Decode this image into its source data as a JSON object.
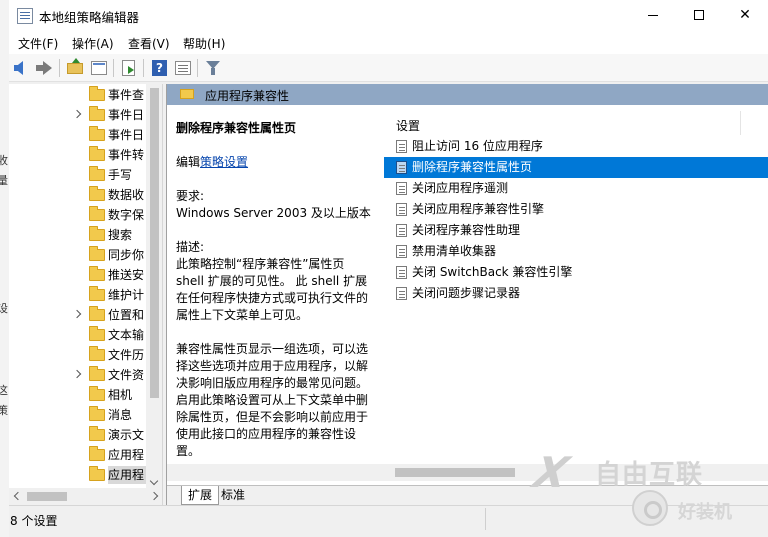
{
  "window": {
    "title": "本地组策略编辑器"
  },
  "menu": [
    "文件(F)",
    "操作(A)",
    "查看(V)",
    "帮助(H)"
  ],
  "toolbar": {
    "icons": [
      "back-arrow-icon",
      "forward-arrow-icon",
      "up-folder-icon",
      "show-hide-console-tree-icon",
      "export-list-icon",
      "help-icon",
      "properties-icon",
      "filter-icon"
    ]
  },
  "left_strip": [
    "收",
    "量",
    "设",
    "这",
    "策"
  ],
  "tree": {
    "items": [
      {
        "label": "事件查",
        "expandable": false
      },
      {
        "label": "事件日",
        "expandable": true
      },
      {
        "label": "事件日",
        "expandable": false
      },
      {
        "label": "事件转",
        "expandable": false
      },
      {
        "label": "手写",
        "expandable": false
      },
      {
        "label": "数据收",
        "expandable": false
      },
      {
        "label": "数字保",
        "expandable": false
      },
      {
        "label": "搜索",
        "expandable": false
      },
      {
        "label": "同步你",
        "expandable": false
      },
      {
        "label": "推送安",
        "expandable": false
      },
      {
        "label": "维护计",
        "expandable": false
      },
      {
        "label": "位置和",
        "expandable": true
      },
      {
        "label": "文本输",
        "expandable": false
      },
      {
        "label": "文件历",
        "expandable": false
      },
      {
        "label": "文件资",
        "expandable": true
      },
      {
        "label": "相机",
        "expandable": false
      },
      {
        "label": "消息",
        "expandable": false
      },
      {
        "label": "演示文",
        "expandable": false
      },
      {
        "label": "应用程",
        "expandable": false
      },
      {
        "label": "应用程",
        "expandable": false,
        "selected": true
      }
    ]
  },
  "header": {
    "title": "应用程序兼容性"
  },
  "extended": {
    "title": "删除程序兼容性属性页",
    "edit_prefix": "编辑",
    "edit_link": "策略设置",
    "req_label": "要求:",
    "req_value": "Windows Server 2003 及以上版本",
    "desc_label": "描述:",
    "desc_p1": "此策略控制“程序兼容性”属性页 shell 扩展的可见性。 此 shell 扩展在任何程序快捷方式或可执行文件的属性上下文菜单上可见。",
    "desc_p2": "兼容性属性页显示一组选项，可以选择这些选项并应用于应用程序，以解决影响旧版应用程序的最常见问题。启用此策略设置可从上下文菜单中删除属性页，但是不会影响以前应用于使用此接口的应用程序的兼容性设置。"
  },
  "list": {
    "header": "设置",
    "items": [
      {
        "label": "阻止访问 16 位应用程序"
      },
      {
        "label": "删除程序兼容性属性页",
        "selected": true
      },
      {
        "label": "关闭应用程序遥测"
      },
      {
        "label": "关闭应用程序兼容性引擎"
      },
      {
        "label": "关闭程序兼容性助理"
      },
      {
        "label": "禁用清单收集器"
      },
      {
        "label": "关闭 SwitchBack 兼容性引擎"
      },
      {
        "label": "关闭问题步骤记录器"
      }
    ]
  },
  "tabs": [
    "扩展",
    "标准"
  ],
  "status": {
    "text": "8 个设置"
  },
  "watermarks": {
    "brand1_mark": "X",
    "brand1": "自由互联",
    "brand2": "好装机"
  },
  "colors": {
    "selection": "#0078d7",
    "header_band": "#8fa7c4",
    "link": "#0645ad"
  }
}
